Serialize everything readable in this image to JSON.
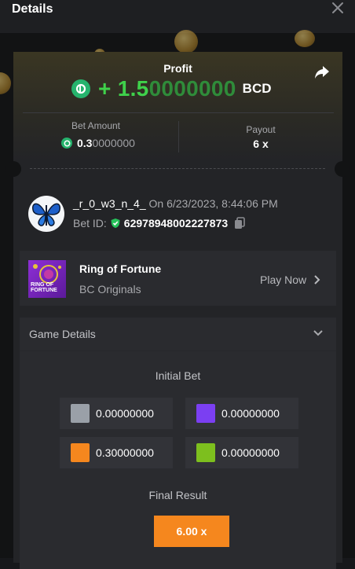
{
  "header": {
    "title": "Details"
  },
  "profit": {
    "label": "Profit",
    "sign": "+ ",
    "value_main": "1.5",
    "value_rest": "0000000",
    "currency": "BCD"
  },
  "bet_amount": {
    "label": "Bet Amount",
    "value_main": "0.3",
    "value_rest": "0000000"
  },
  "payout": {
    "label": "Payout",
    "value": "6 x"
  },
  "user": {
    "name": "_r_0_w3_n_4_",
    "date": "On 6/23/2023, 8:44:06 PM",
    "bet_id_label": "Bet ID:",
    "bet_id": "62978948002227873"
  },
  "game": {
    "name": "Ring of Fortune",
    "provider": "BC Originals",
    "thumb_text": "RING OF FORTUNE",
    "play_label": "Play Now"
  },
  "details": {
    "title": "Game Details",
    "initial_bet_label": "Initial Bet",
    "bets": [
      {
        "color": "#9aa0a8",
        "value": "0.00000000"
      },
      {
        "color": "#7b3ff2",
        "value": "0.00000000"
      },
      {
        "color": "#f5871e",
        "value": "0.30000000"
      },
      {
        "color": "#7dbf1e",
        "value": "0.00000000"
      }
    ],
    "final_result_label": "Final Result",
    "final_result": "6.00 x"
  },
  "colors": {
    "accent_green": "#3fd14b",
    "bcd_green": "#26b36d",
    "orange": "#f5871e"
  }
}
